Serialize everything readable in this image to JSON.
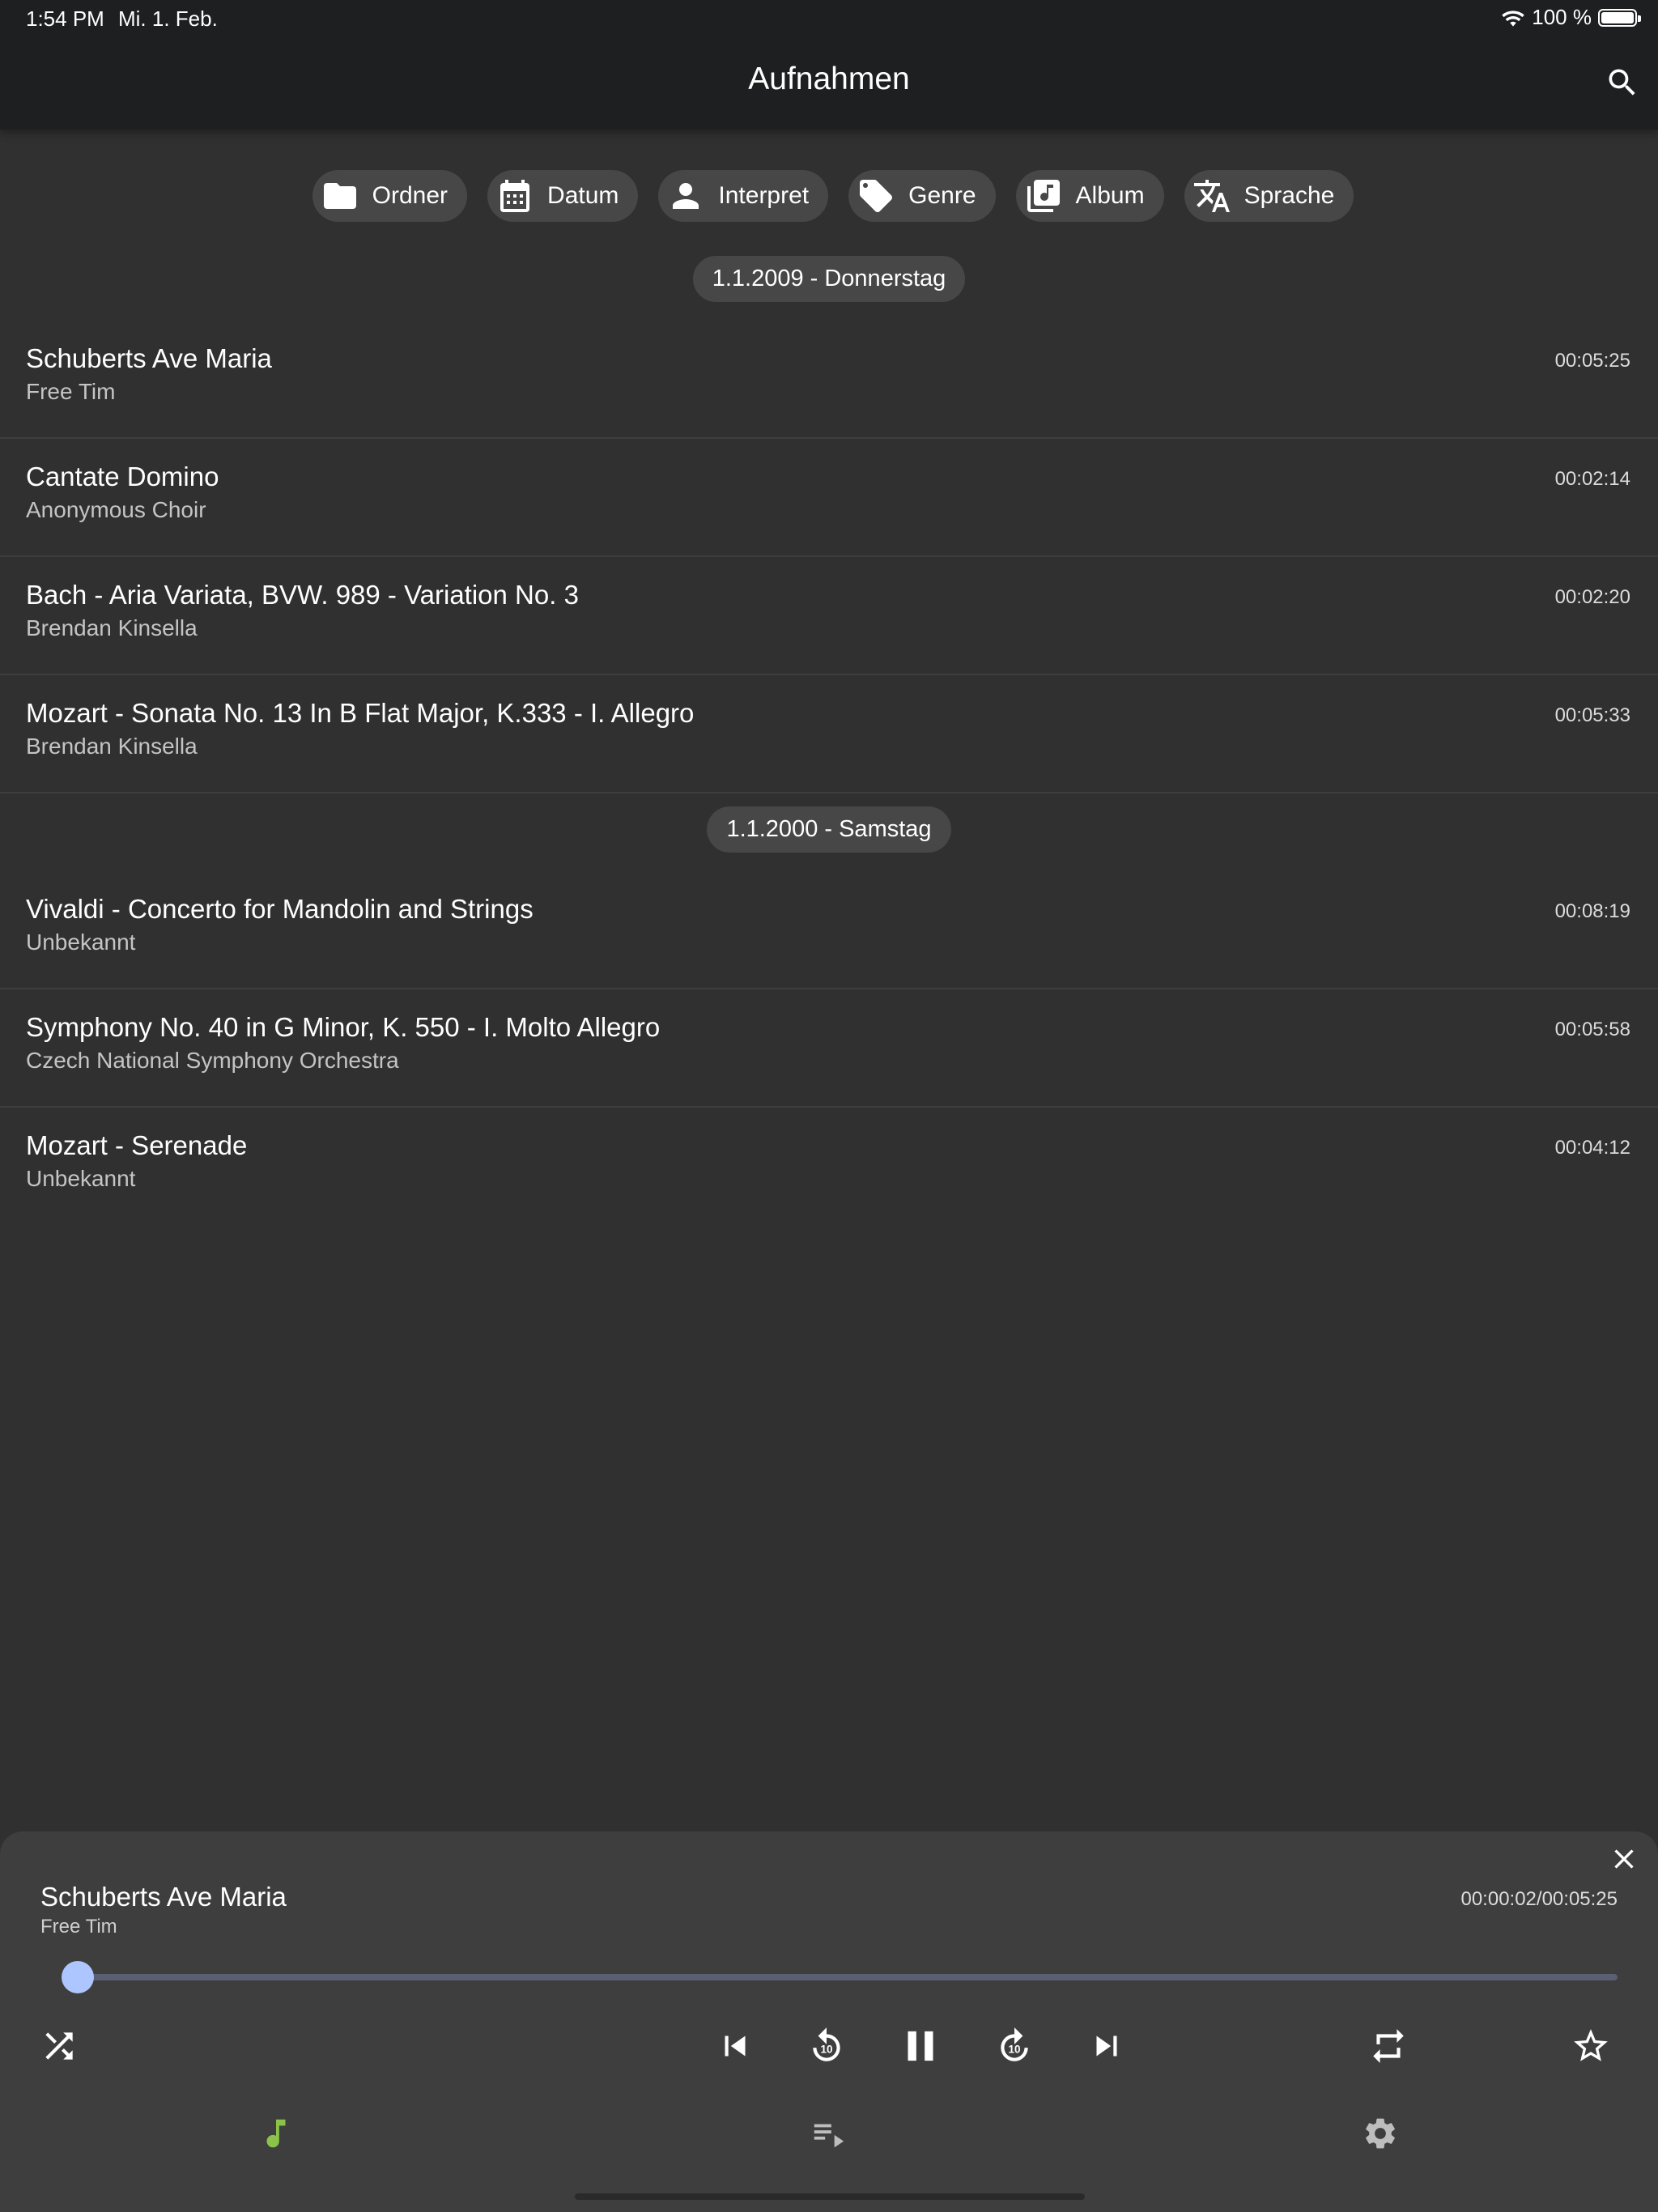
{
  "status": {
    "time": "1:54 PM",
    "date": "Mi. 1. Feb.",
    "battery": "100 %",
    "battery_level": 1.0
  },
  "appbar": {
    "title": "Aufnahmen",
    "search_icon": "search-icon"
  },
  "filters": [
    {
      "label": "Ordner",
      "icon": "folder-icon"
    },
    {
      "label": "Datum",
      "icon": "calendar-icon"
    },
    {
      "label": "Interpret",
      "icon": "person-icon"
    },
    {
      "label": "Genre",
      "icon": "tag-icon"
    },
    {
      "label": "Album",
      "icon": "album-icon"
    },
    {
      "label": "Sprache",
      "icon": "translate-icon"
    }
  ],
  "groups": [
    {
      "date": "1.1.2009 - Donnerstag",
      "items": [
        {
          "title": "Schuberts Ave Maria",
          "artist": "Free Tim",
          "duration": "00:05:25"
        },
        {
          "title": "Cantate Domino",
          "artist": "Anonymous Choir",
          "duration": "00:02:14"
        },
        {
          "title": "Bach - Aria Variata, BVW. 989 - Variation No. 3",
          "artist": "Brendan Kinsella",
          "duration": "00:02:20"
        },
        {
          "title": "Mozart - Sonata No. 13 In B Flat Major, K.333 - I. Allegro",
          "artist": "Brendan Kinsella",
          "duration": "00:05:33"
        }
      ]
    },
    {
      "date": "1.1.2000 - Samstag",
      "items": [
        {
          "title": "Vivaldi - Concerto for Mandolin and Strings",
          "artist": "Unbekannt",
          "duration": "00:08:19"
        },
        {
          "title": "Symphony No. 40 in G Minor, K. 550 - I. Molto Allegro",
          "artist": "Czech National Symphony Orchestra",
          "duration": "00:05:58"
        },
        {
          "title": "Mozart - Serenade",
          "artist": "Unbekannt",
          "duration": "00:04:12"
        }
      ]
    }
  ],
  "player": {
    "title": "Schuberts Ave Maria",
    "artist": "Free Tim",
    "time": "00:00:02/00:05:25",
    "progress": 0.006,
    "accent_color": "#adc6ff",
    "controls": [
      "shuffle-icon",
      "skip-previous-icon",
      "replay-10-icon",
      "pause-icon",
      "forward-10-icon",
      "skip-next-icon",
      "repeat-icon",
      "star-outline-icon"
    ]
  },
  "bottom_nav": [
    {
      "icon": "music-note-icon",
      "active": true,
      "color": "#8bc34a"
    },
    {
      "icon": "queue-icon",
      "active": false
    },
    {
      "icon": "settings-icon",
      "active": false
    }
  ]
}
